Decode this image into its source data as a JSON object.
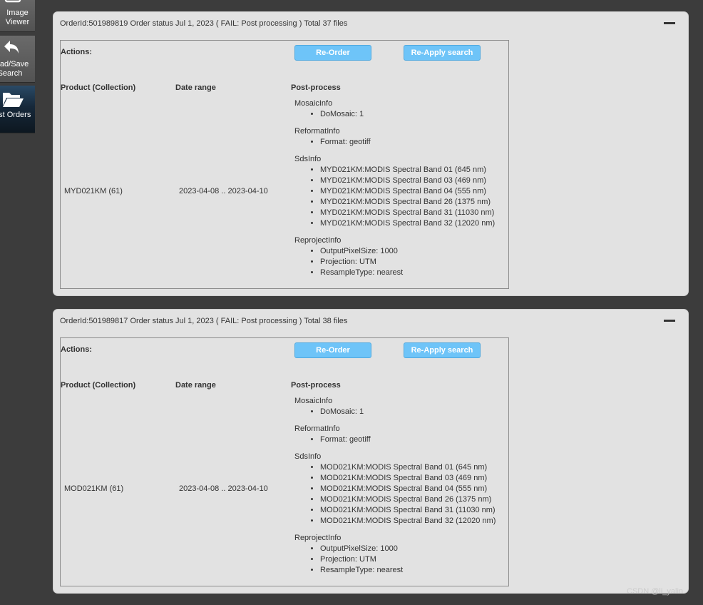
{
  "sidebar": {
    "image_viewer_label": "Image Viewer",
    "load_save_label": "Load/Save Search",
    "past_orders_label": "Past Orders"
  },
  "orders": [
    {
      "header": "OrderId:501989819 Order status Jul 1, 2023 ( FAIL: Post processing ) Total 37 files",
      "actions_label": "Actions:",
      "reorder_label": "Re-Order",
      "reapply_label": "Re-Apply search",
      "col_product": "Product (Collection)",
      "col_date": "Date range",
      "col_post": "Post-process",
      "product": "MYD021KM (61)",
      "date_range": "2023-04-08 .. 2023-04-10",
      "mosaic_title": "MosaicInfo",
      "mosaic_items": [
        "DoMosaic: 1"
      ],
      "reformat_title": "ReformatInfo",
      "reformat_items": [
        "Format: geotiff"
      ],
      "sds_title": "SdsInfo",
      "sds_items": [
        "MYD021KM:MODIS Spectral Band 01 (645 nm)",
        "MYD021KM:MODIS Spectral Band 03 (469 nm)",
        "MYD021KM:MODIS Spectral Band 04 (555 nm)",
        "MYD021KM:MODIS Spectral Band 26 (1375 nm)",
        "MYD021KM:MODIS Spectral Band 31 (11030 nm)",
        "MYD021KM:MODIS Spectral Band 32 (12020 nm)"
      ],
      "reproject_title": "ReprojectInfo",
      "reproject_items": [
        "OutputPixelSize: 1000",
        "Projection: UTM",
        "ResampleType: nearest"
      ]
    },
    {
      "header": "OrderId:501989817 Order status Jul 1, 2023 ( FAIL: Post processing ) Total 38 files",
      "actions_label": "Actions:",
      "reorder_label": "Re-Order",
      "reapply_label": "Re-Apply search",
      "col_product": "Product (Collection)",
      "col_date": "Date range",
      "col_post": "Post-process",
      "product": "MOD021KM (61)",
      "date_range": "2023-04-08 .. 2023-04-10",
      "mosaic_title": "MosaicInfo",
      "mosaic_items": [
        "DoMosaic: 1"
      ],
      "reformat_title": "ReformatInfo",
      "reformat_items": [
        "Format: geotiff"
      ],
      "sds_title": "SdsInfo",
      "sds_items": [
        "MOD021KM:MODIS Spectral Band 01 (645 nm)",
        "MOD021KM:MODIS Spectral Band 03 (469 nm)",
        "MOD021KM:MODIS Spectral Band 04 (555 nm)",
        "MOD021KM:MODIS Spectral Band 26 (1375 nm)",
        "MOD021KM:MODIS Spectral Band 31 (11030 nm)",
        "MOD021KM:MODIS Spectral Band 32 (12020 nm)"
      ],
      "reproject_title": "ReprojectInfo",
      "reproject_items": [
        "OutputPixelSize: 1000",
        "Projection: UTM",
        "ResampleType: nearest"
      ]
    }
  ],
  "watermark": "CSDN @li_yalin",
  "colors": {
    "page_background": "#3c3c3c",
    "panel_background": "#e2e2e2",
    "button_blue": "#6ec4f8",
    "sidebar_active": "#16283a"
  }
}
